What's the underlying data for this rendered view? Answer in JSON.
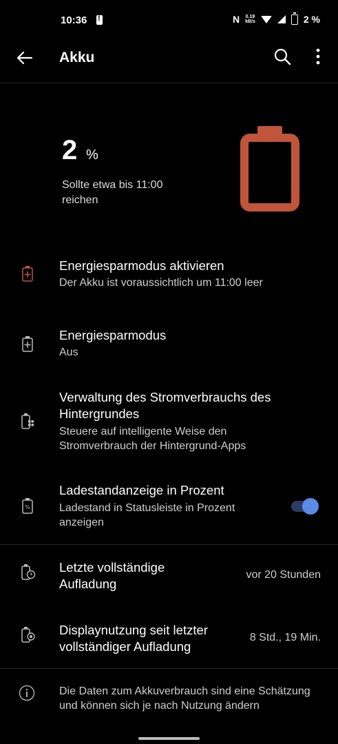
{
  "status_bar": {
    "time": "10:36",
    "net_speed_value": "0.19",
    "net_speed_unit": "kB/s",
    "battery_percent": "2 %",
    "nfc": "N"
  },
  "app_bar": {
    "title": "Akku"
  },
  "summary": {
    "percent_value": "2",
    "percent_sign": "%",
    "estimate": "Sollte etwa bis 11:00 reichen",
    "battery_color": "#c0553a"
  },
  "items": [
    {
      "title": "Energiesparmodus aktivieren",
      "subtitle": "Der Akku ist voraussichtlich um 11:00 leer",
      "icon": "battery-plus-icon"
    },
    {
      "title": "Energiesparmodus",
      "subtitle": "Aus",
      "icon": "battery-saver-icon"
    },
    {
      "title": "Verwaltung des Stromverbrauchs des Hintergrundes",
      "subtitle": "Steuere auf intelligente Weise den Stromverbrauch der Hintergrund-Apps",
      "icon": "battery-apps-icon"
    },
    {
      "title": "Ladestandanzeige in Prozent",
      "subtitle": "Ladestand in Statusleiste in Prozent anzeigen",
      "icon": "battery-percent-icon",
      "toggle_on": true
    }
  ],
  "stats": [
    {
      "title": "Letzte vollständige Aufladung",
      "value": "vor 20 Stunden",
      "icon": "battery-clock-icon"
    },
    {
      "title": "Displaynutzung seit letzter vollständiger Aufladung",
      "value": "8 Std., 19 Min.",
      "icon": "battery-screen-icon"
    }
  ],
  "footer": {
    "info": "Die Daten zum Akkuverbrauch sind eine Schätzung und können sich je nach Nutzung ändern",
    "icon": "info-icon"
  },
  "colors": {
    "accent": "#5b8ae6",
    "battery_low": "#c0553a",
    "background": "#000000"
  }
}
